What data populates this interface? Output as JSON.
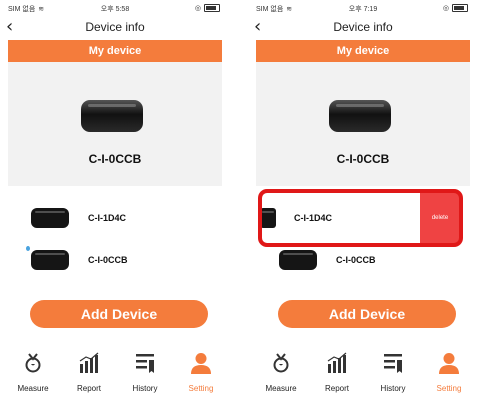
{
  "left": {
    "status": {
      "carrier": "SIM 없음",
      "time": "오후 5:58"
    },
    "nav_title": "Device info",
    "banner": "My device",
    "current_device": "C-I-0CCB",
    "devices": [
      "C-I-1D4C",
      "C-I-0CCB"
    ],
    "add_button": "Add Device"
  },
  "right": {
    "status": {
      "carrier": "SIM 없음",
      "time": "오후 7:19"
    },
    "nav_title": "Device info",
    "banner": "My device",
    "current_device": "C-I-0CCB",
    "devices": [
      "C-I-1D4C",
      "C-I-0CCB"
    ],
    "delete_label": "delete",
    "add_button": "Add Device"
  },
  "tabs": [
    {
      "label": "Measure",
      "icon": "measure-icon"
    },
    {
      "label": "Report",
      "icon": "report-icon"
    },
    {
      "label": "History",
      "icon": "history-icon"
    },
    {
      "label": "Setting",
      "icon": "setting-icon",
      "active": true
    }
  ],
  "colors": {
    "accent": "#f47c3c",
    "delete": "#ef4343",
    "highlight": "#e01818",
    "hero_bg": "#f2f2f2"
  }
}
